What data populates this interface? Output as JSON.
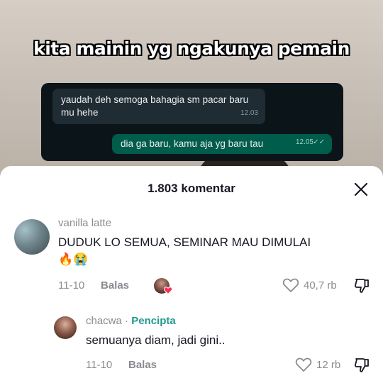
{
  "video": {
    "overlay_title": "kita mainin yg ngakunya pemain",
    "chat": {
      "incoming": {
        "text": "yaudah deh semoga bahagia sm pacar baru mu hehe",
        "time": "12.03"
      },
      "outgoing": {
        "text": "dia ga baru, kamu aja yg baru tau",
        "time": "12.05",
        "status_icon": "double-check-icon"
      }
    }
  },
  "comments_sheet": {
    "title": "1.803 komentar",
    "close_icon": "close-icon",
    "comments": [
      {
        "username": "vanilla latte",
        "text": "DUDUK LO SEMUA, SEMINAR MAU DIMULAI",
        "emojis": "🔥😭",
        "date": "11-10",
        "reply_label": "Balas",
        "likes": "40,7 rb"
      },
      {
        "username": "chacwa",
        "creator_badge": "Pencipta",
        "separator": "·",
        "text": "semuanya diam, jadi gini..",
        "date": "11-10",
        "reply_label": "Balas",
        "likes": "12 rb"
      }
    ]
  },
  "colors": {
    "creator_accent": "#1f9a8f",
    "text_primary": "#161823",
    "text_secondary": "#8a8b91",
    "chat_outgoing": "#005c4b",
    "chat_incoming": "#1f2c33",
    "liked_heart": "#fe2c55"
  }
}
